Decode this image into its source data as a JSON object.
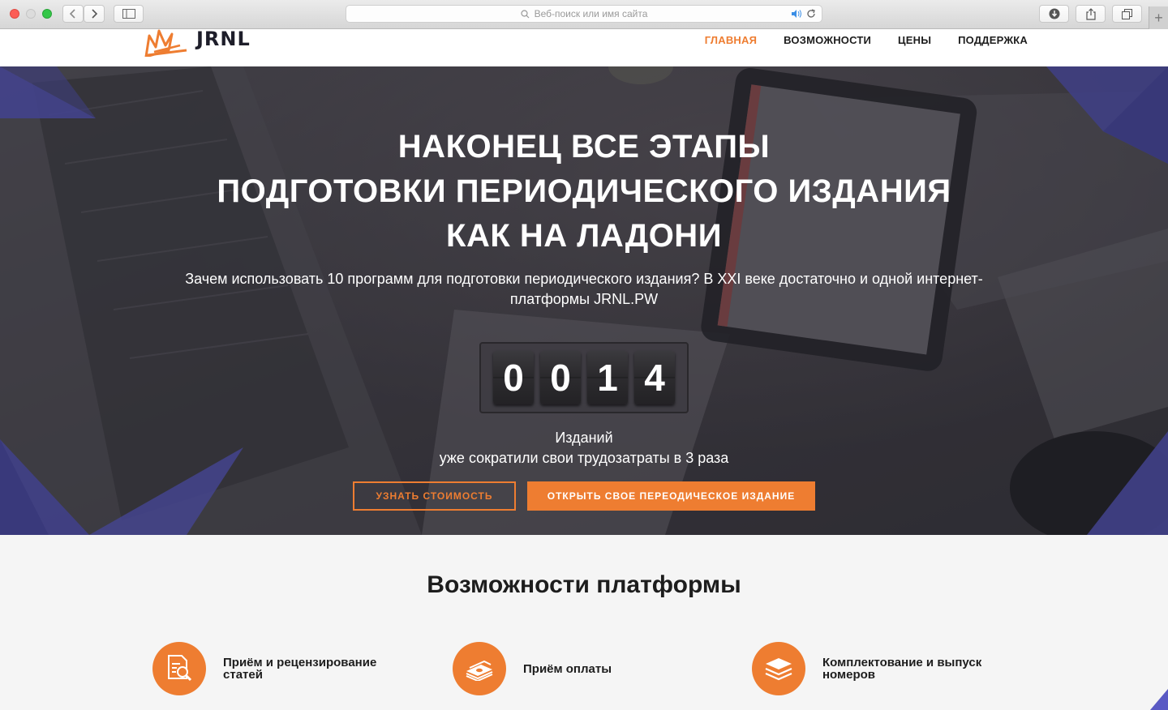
{
  "browser": {
    "address_placeholder": "Веб-поиск или имя сайта"
  },
  "header": {
    "logo_text": "JRNL",
    "nav": [
      {
        "label": "ГЛАВНАЯ",
        "active": true
      },
      {
        "label": "ВОЗМОЖНОСТИ",
        "active": false
      },
      {
        "label": "ЦЕНЫ",
        "active": false
      },
      {
        "label": "ПОДДЕРЖКА",
        "active": false
      }
    ]
  },
  "hero": {
    "title_lines": [
      "НАКОНЕЦ ВСЕ ЭТАПЫ",
      "ПОДГОТОВКИ ПЕРИОДИЧЕСКОГО ИЗДАНИЯ",
      "КАК НА ЛАДОНИ"
    ],
    "lead_line1": "Зачем использовать 10 программ для подготовки периодического издания? В XXI веке достаточно и одной интернет-",
    "lead_line2": "платформы JRNL.PW",
    "counter_digits": [
      "0",
      "0",
      "1",
      "4"
    ],
    "caption_line1": "Изданий",
    "caption_line2": "уже сократили свои трудозатраты в 3 раза",
    "btn_price": "УЗНАТЬ СТОИМОСТЬ",
    "btn_open": "ОТКРЫТЬ СВОЕ ПЕРЕОДИЧЕСКОЕ ИЗДАНИЕ"
  },
  "features": {
    "title": "Возможности платформы",
    "items": [
      {
        "label": "Приём и рецензирование статей",
        "icon": "document-search-icon"
      },
      {
        "label": "Приём оплаты",
        "icon": "money-stack-icon"
      },
      {
        "label": "Комплектование и выпуск номеров",
        "icon": "layers-icon"
      }
    ]
  },
  "colors": {
    "accent": "#ee7d31",
    "decor_purple": "#4f4fb8",
    "hero_overlay": "#3e3b43"
  }
}
